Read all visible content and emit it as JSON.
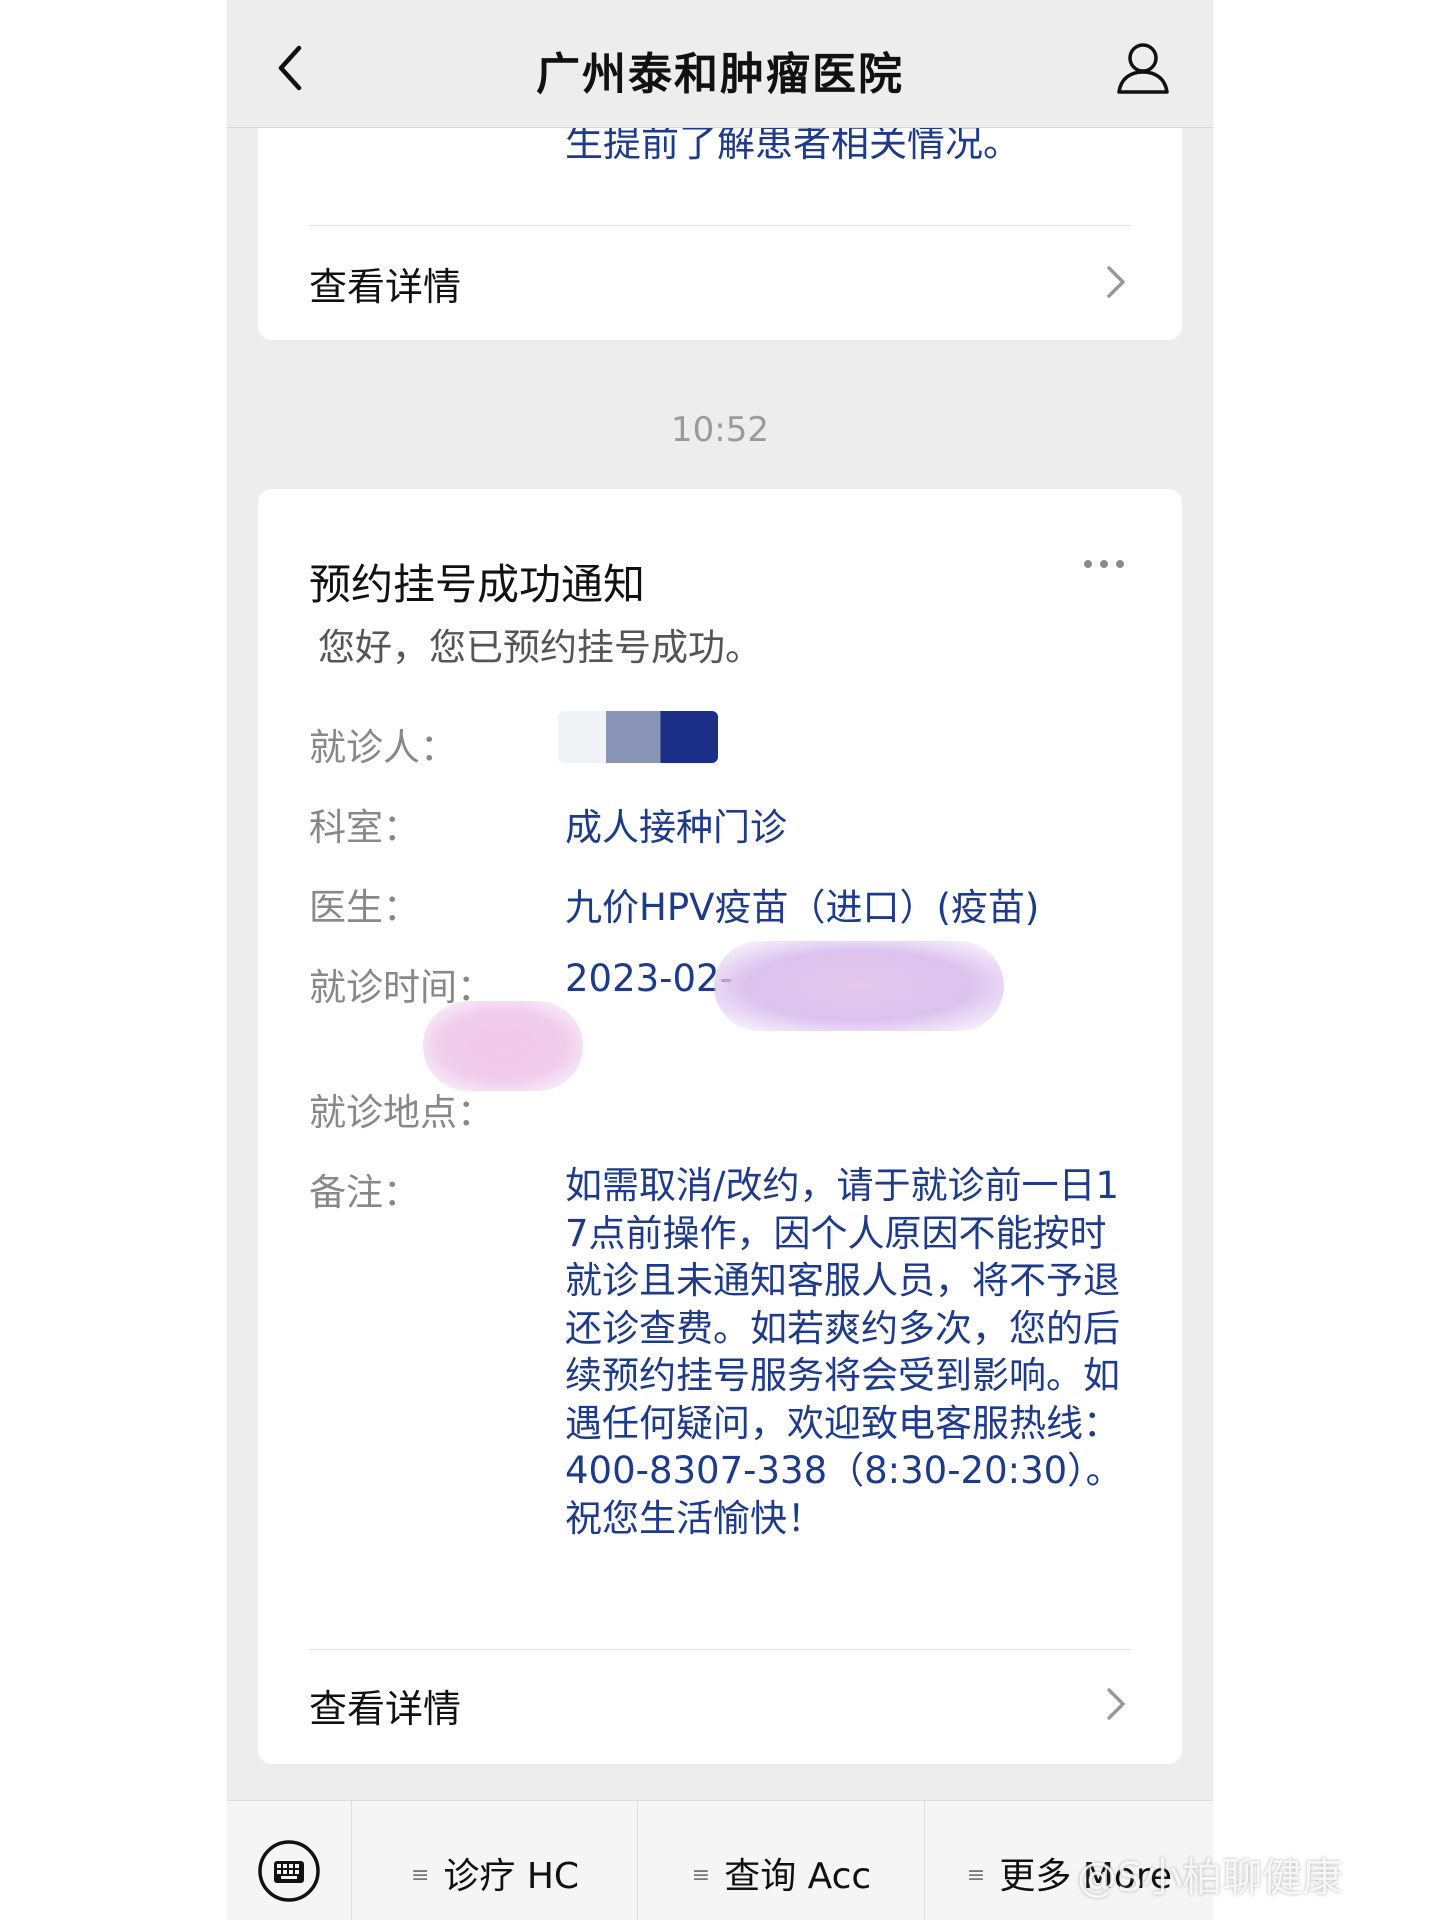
{
  "nav": {
    "title": "广州泰和肿瘤医院"
  },
  "prev_card": {
    "text_fragment": "生提前了解患者相关情况。",
    "detail_label": "查看详情"
  },
  "timestamp": "10:52",
  "notice": {
    "title": "预约挂号成功通知",
    "subtitle": "您好，您已预约挂号成功。",
    "fields": [
      {
        "label": "就诊人：",
        "value": ""
      },
      {
        "label": "科室：",
        "value": "成人接种门诊"
      },
      {
        "label": "医生：",
        "value": "九价HPV疫苗（进口）(疫苗)"
      },
      {
        "label": "就诊时间：",
        "value": "2023-02-"
      },
      {
        "label": "就诊地点：",
        "value": ""
      },
      {
        "label": "备注：",
        "value": "如需取消/改约，请于就诊前一日17点前操作，因个人原因不能按时就诊且未通知客服人员，将不予退还诊查费。如若爽约多次，您的后续预约挂号服务将会受到影响。如遇任何疑问，欢迎致电客服热线：400-8307-338（8:30-20:30）。祝您生活愉快！"
      }
    ],
    "detail_label": "查看详情"
  },
  "bottom_menu": {
    "items": [
      "诊疗 HC",
      "查询 Acc",
      "更多 More"
    ]
  },
  "watermark": "@S小柏聊健康",
  "colors": {
    "accent_blue": "#1e3a8a",
    "background": "#ededed"
  }
}
